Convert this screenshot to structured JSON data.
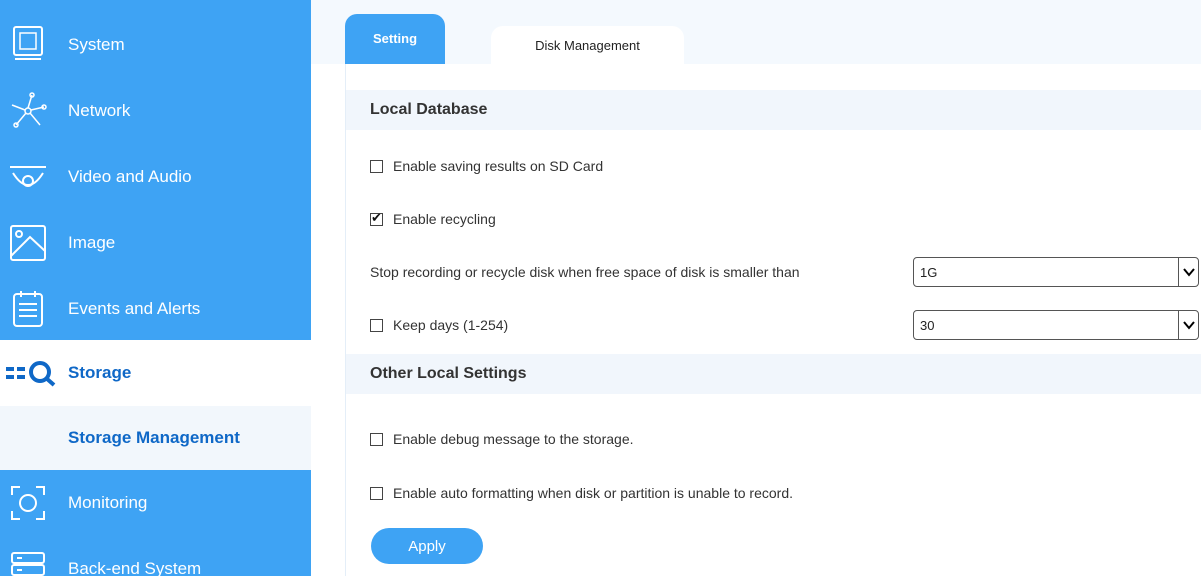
{
  "sidebar": {
    "items": [
      {
        "label": "System",
        "icon": "system-icon"
      },
      {
        "label": "Network",
        "icon": "network-icon"
      },
      {
        "label": "Video and Audio",
        "icon": "camera-icon"
      },
      {
        "label": "Image",
        "icon": "image-icon"
      },
      {
        "label": "Events and Alerts",
        "icon": "events-icon"
      },
      {
        "label": "Storage",
        "icon": "storage-icon"
      },
      {
        "label": "Monitoring",
        "icon": "monitoring-icon"
      },
      {
        "label": "Back-end System",
        "icon": "backend-icon"
      }
    ],
    "sub_item": "Storage Management"
  },
  "tabs": {
    "setting": "Setting",
    "disk_management": "Disk Management"
  },
  "local_database": {
    "title": "Local Database",
    "save_sd": {
      "label": "Enable saving results on SD Card",
      "checked": false
    },
    "recycling": {
      "label": "Enable recycling",
      "checked": true
    },
    "stop_label": "Stop recording or recycle disk when free space of disk is smaller than",
    "stop_value": "1G",
    "keep_days": {
      "label": "Keep days (1-254)",
      "checked": false
    },
    "keep_days_value": "30"
  },
  "other_settings": {
    "title": "Other Local Settings",
    "debug": {
      "label": "Enable debug message to the storage.",
      "checked": false
    },
    "auto_format": {
      "label": "Enable auto formatting when disk or partition is unable to record.",
      "checked": false
    }
  },
  "apply_label": "Apply",
  "colors": {
    "accent": "#3ea3f4",
    "active_text": "#0f68c7"
  }
}
